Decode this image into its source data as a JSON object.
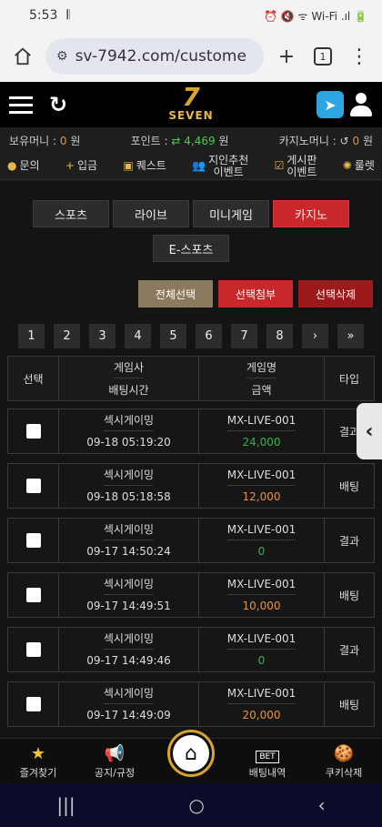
{
  "status": {
    "time": "5:53",
    "icons": "⏰ 🔇 ᯤ Wi-Fi .ıl 🔋"
  },
  "browser": {
    "url": "sv-7942.com/custome",
    "tabs": "1"
  },
  "header": {
    "logo_num": "7",
    "logo_text": "SEVEN"
  },
  "balance": {
    "money_label": "보유머니 :",
    "money_val": "0",
    "money_unit": "원",
    "point_label": "포인트 :",
    "point_val": "4,469",
    "point_unit": "원",
    "casino_label": "카지노머니 :",
    "casino_val": "0",
    "casino_unit": "원"
  },
  "quickmenu": [
    {
      "label": "문의",
      "icon": "●"
    },
    {
      "label": "입금",
      "icon": "+"
    },
    {
      "label": "퀘스트",
      "icon": "▣"
    },
    {
      "label": "지인추천\n이벤트",
      "icon": "👥"
    },
    {
      "label": "게시판\n이벤트",
      "icon": "☑"
    },
    {
      "label": "룰렛",
      "icon": "✺"
    }
  ],
  "categories": [
    "스포츠",
    "라이브",
    "미니게임",
    "카지노",
    "E-스포츠"
  ],
  "actions": {
    "select_all": "전체선택",
    "attach": "선택첨부",
    "delete": "선택삭제"
  },
  "pages": [
    "1",
    "2",
    "3",
    "4",
    "5",
    "6",
    "7",
    "8",
    "›",
    "»"
  ],
  "table": {
    "head": {
      "select": "선택",
      "provider": "게임사",
      "time": "배팅시간",
      "game": "게임명",
      "amount": "금액",
      "type": "타입"
    },
    "rows": [
      {
        "provider": "섹시게이밍",
        "time": "09-18 05:19:20",
        "game": "MX-LIVE-001",
        "amount": "24,000",
        "type": "결과",
        "color": "g"
      },
      {
        "provider": "섹시게이밍",
        "time": "09-18 05:18:58",
        "game": "MX-LIVE-001",
        "amount": "12,000",
        "type": "배팅",
        "color": "o"
      },
      {
        "provider": "섹시게이밍",
        "time": "09-17 14:50:24",
        "game": "MX-LIVE-001",
        "amount": "0",
        "type": "결과",
        "color": "g"
      },
      {
        "provider": "섹시게이밍",
        "time": "09-17 14:49:51",
        "game": "MX-LIVE-001",
        "amount": "10,000",
        "type": "배팅",
        "color": "o"
      },
      {
        "provider": "섹시게이밍",
        "time": "09-17 14:49:46",
        "game": "MX-LIVE-001",
        "amount": "0",
        "type": "결과",
        "color": "g"
      },
      {
        "provider": "섹시게이밍",
        "time": "09-17 14:49:09",
        "game": "MX-LIVE-001",
        "amount": "20,000",
        "type": "배팅",
        "color": "o"
      }
    ]
  },
  "bottomnav": {
    "fav": "즐겨찾기",
    "notice": "공지/규정",
    "bets": "배팅내역",
    "cookie": "쿠키삭제",
    "bet_badge": "BET"
  }
}
